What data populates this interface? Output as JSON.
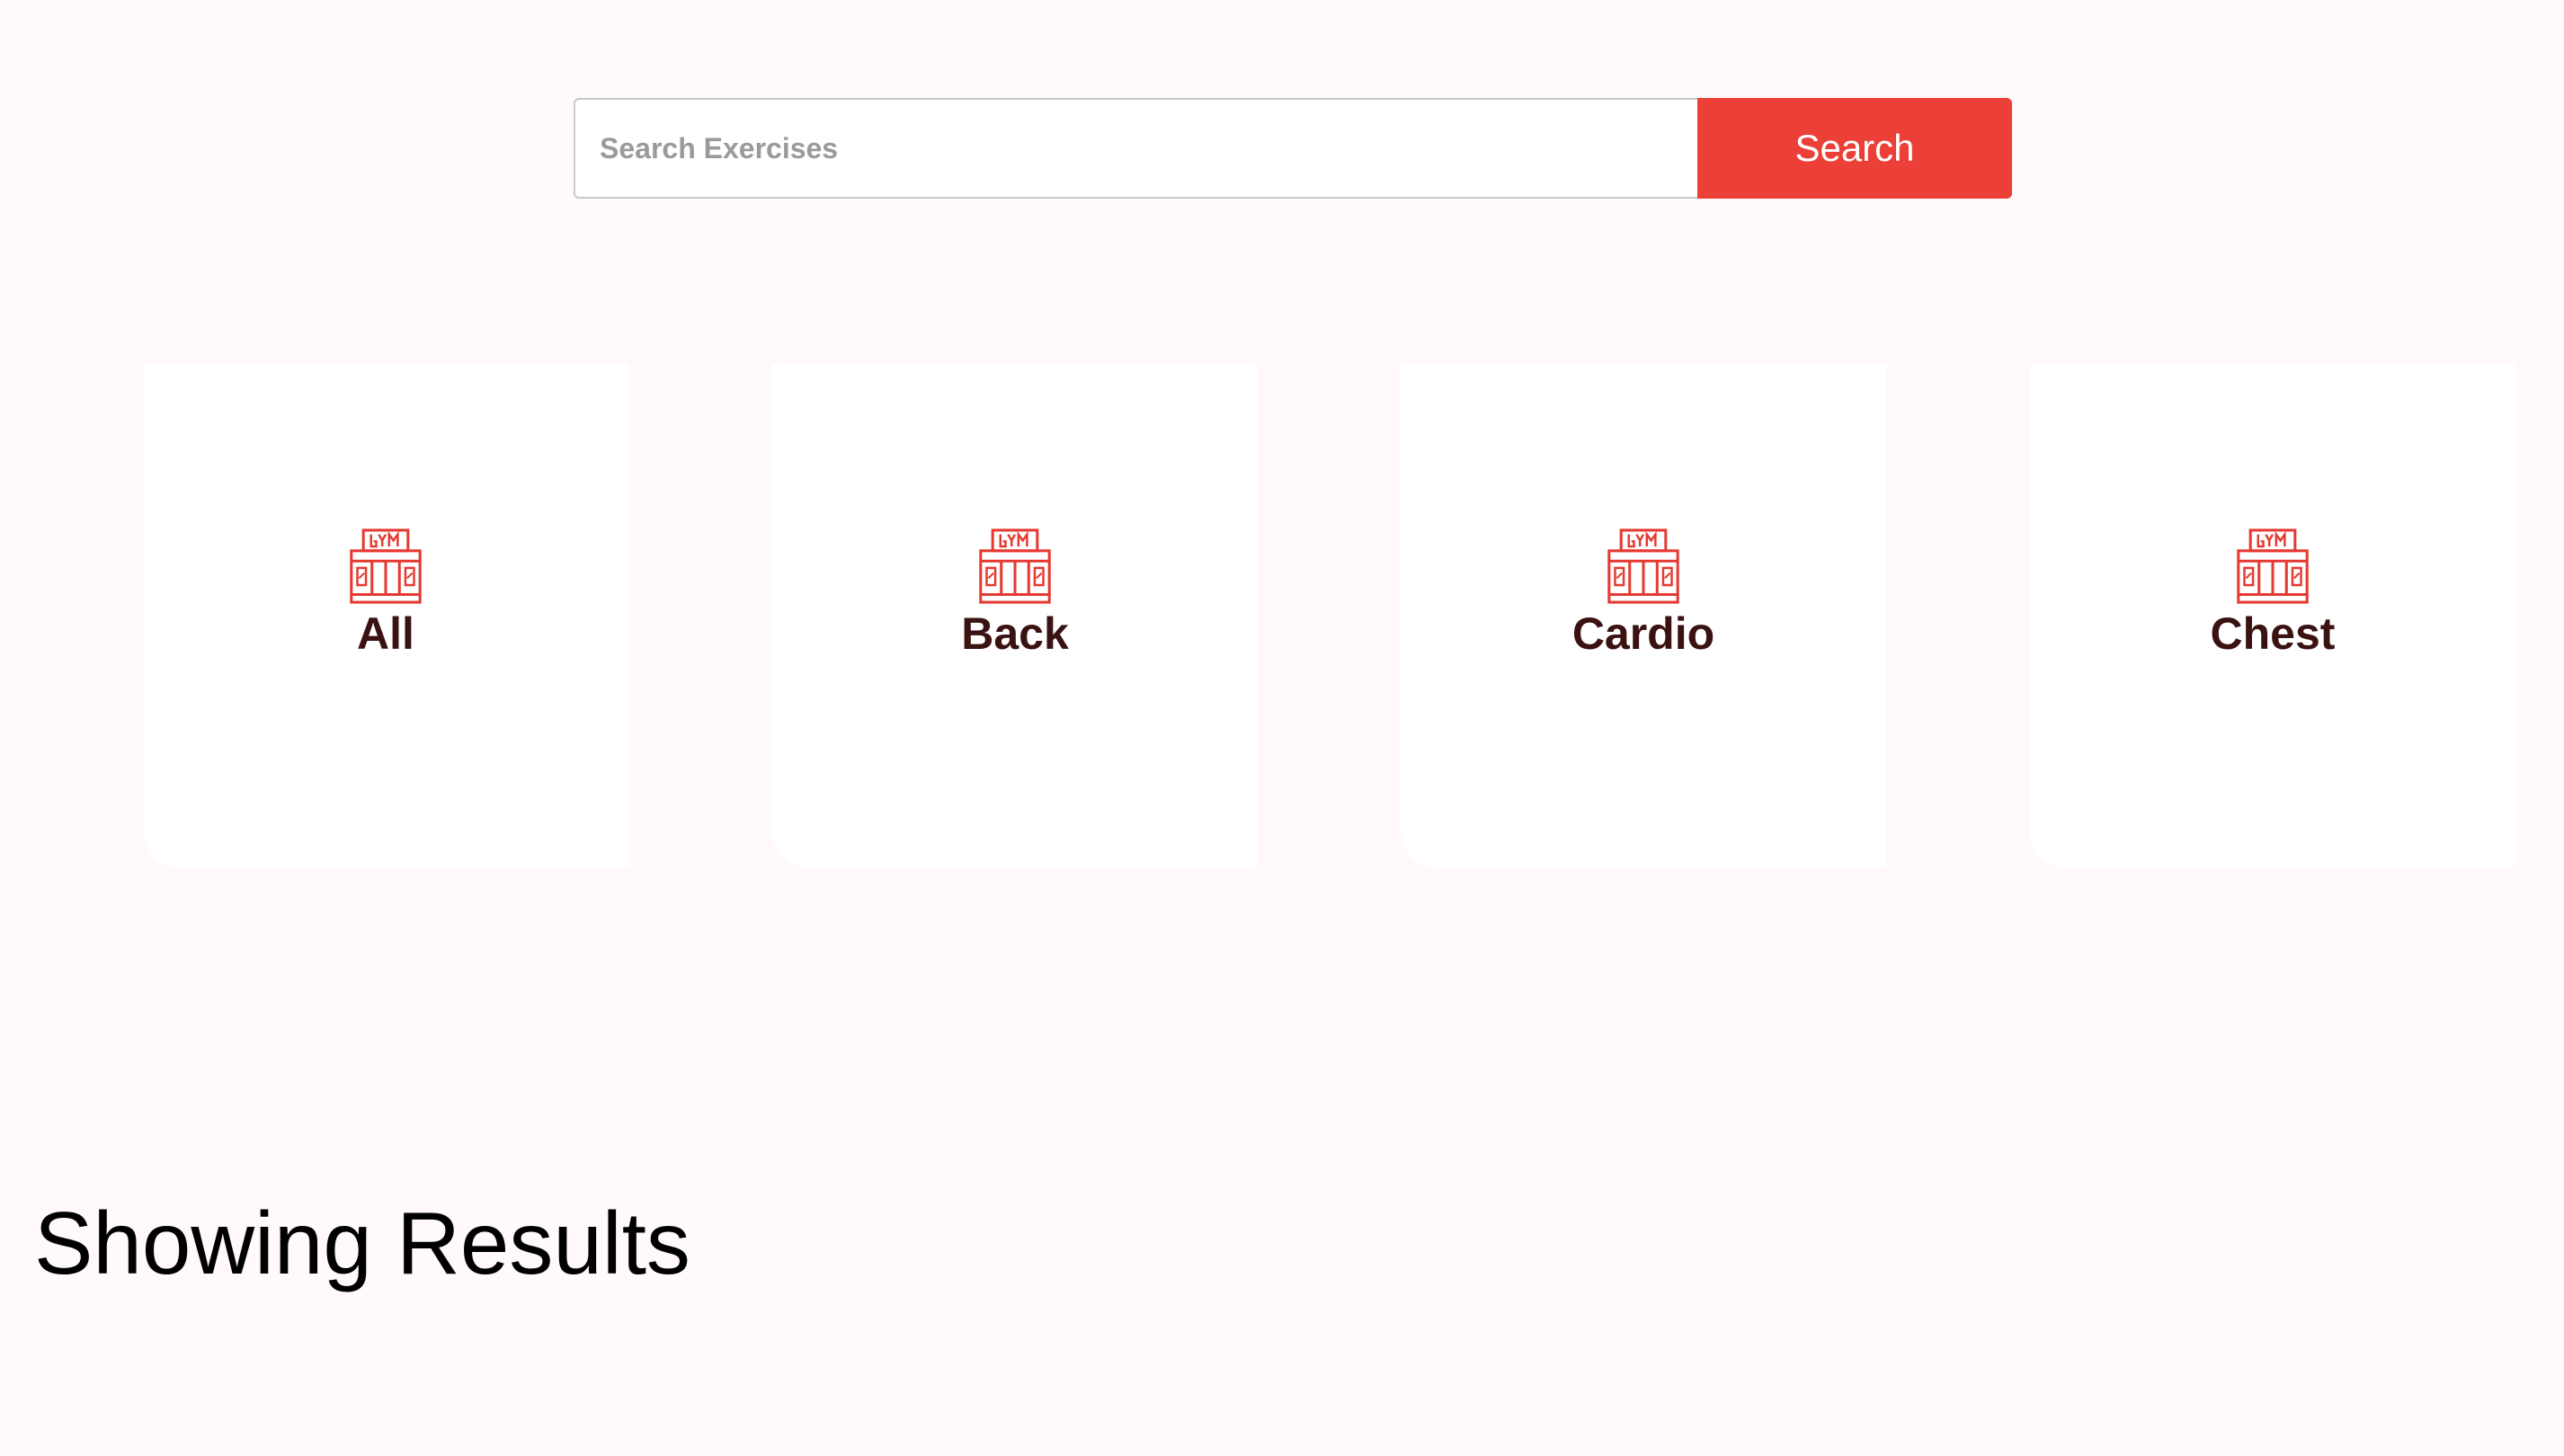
{
  "search": {
    "placeholder": "Search Exercises",
    "value": "",
    "button_label": "Search"
  },
  "categories": [
    {
      "label": "All",
      "icon": "gym-icon"
    },
    {
      "label": "Back",
      "icon": "gym-icon"
    },
    {
      "label": "Cardio",
      "icon": "gym-icon"
    },
    {
      "label": "Chest",
      "icon": "gym-icon"
    }
  ],
  "results": {
    "title": "Showing Results"
  },
  "colors": {
    "accent": "#ec3f37",
    "background": "#fff9f9",
    "card": "#ffffff",
    "label_text": "#3a1212"
  }
}
